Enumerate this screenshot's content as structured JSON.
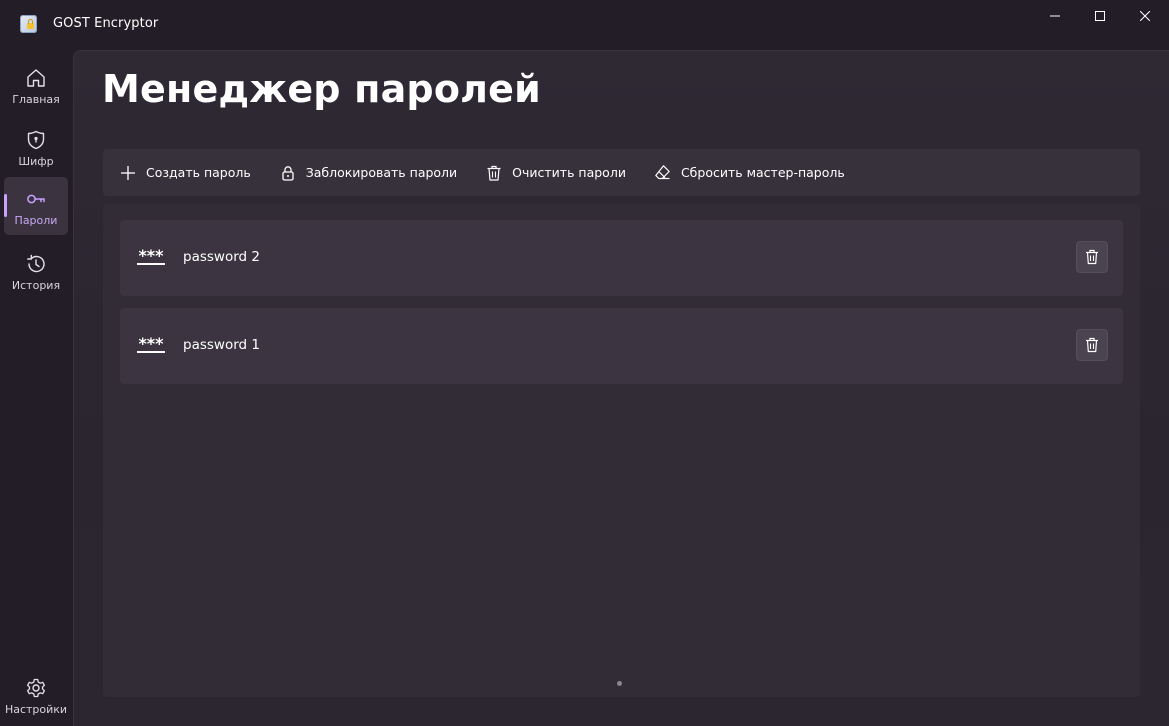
{
  "window": {
    "title": "GOST Encryptor"
  },
  "sidebar": {
    "items": [
      {
        "label": "Главная",
        "icon": "home-icon",
        "active": false
      },
      {
        "label": "Шифр",
        "icon": "shield-icon",
        "active": false
      },
      {
        "label": "Пароли",
        "icon": "key-icon",
        "active": true
      },
      {
        "label": "История",
        "icon": "history-icon",
        "active": false
      }
    ],
    "footer": {
      "label": "Настройки",
      "icon": "gear-icon"
    }
  },
  "page": {
    "title": "Менеджер паролей"
  },
  "toolbar": {
    "create_label": "Создать пароль",
    "lock_label": "Заблокировать пароли",
    "clear_label": "Очистить пароли",
    "reset_label": "Сбросить мастер-пароль"
  },
  "passwords": [
    {
      "name": "password 2",
      "icon_text": "***"
    },
    {
      "name": "password 1",
      "icon_text": "***"
    }
  ],
  "colors": {
    "accent": "#c8a0ff",
    "background": "#231d27",
    "card": "#3c3541"
  }
}
